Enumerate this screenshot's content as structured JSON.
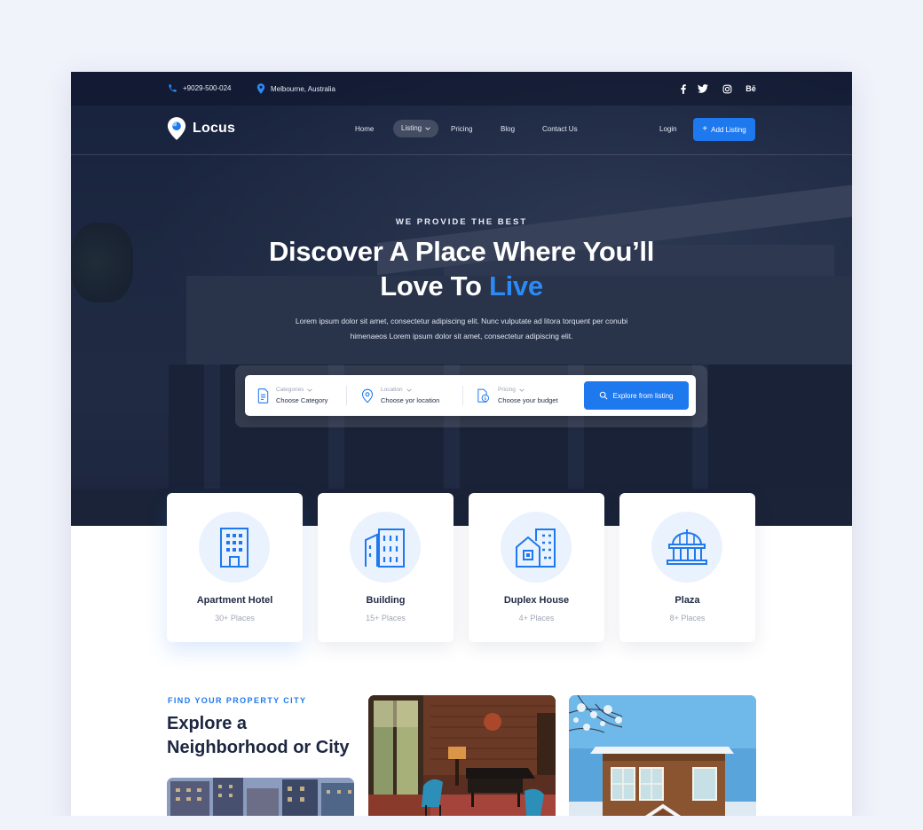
{
  "topbar": {
    "phone": "+9029-500-024",
    "location": "Melbourne, Australia",
    "social": [
      "f",
      "t",
      "ig",
      "Bē"
    ]
  },
  "nav": {
    "brand": "Locus",
    "links": {
      "home": "Home",
      "listing": "Listing",
      "pricing": "Pricing",
      "blog": "Blog",
      "contact": "Contact Us"
    },
    "login": "Login",
    "add_listing": "Add Listing"
  },
  "hero": {
    "eyebrow": "WE PROVIDE THE BEST",
    "title_line1": "Discover A Place Where You’ll",
    "title_line2_prefix": "Love To",
    "title_line2_accent": "Live",
    "lead_line1": "Lorem ipsum dolor sit amet, consectetur adipiscing elit. Nunc vulputate ad litora torquent per conubi",
    "lead_line2": "himenaeos Lorem ipsum dolor sit amet, consectetur adipiscing elit."
  },
  "search": {
    "category_label": "Categories",
    "category_value": "Choose Category",
    "location_label": "Location",
    "location_value": "Choose yor location",
    "pricing_label": "Pricing",
    "pricing_value": "Choose your budget",
    "button": "Explore from listing"
  },
  "categories": [
    {
      "name": "Apartment Hotel",
      "count": "30+ Places",
      "icon": "apartment-icon"
    },
    {
      "name": "Building",
      "count": "15+ Places",
      "icon": "building-icon"
    },
    {
      "name": "Duplex House",
      "count": "4+ Places",
      "icon": "duplex-house-icon"
    },
    {
      "name": "Plaza",
      "count": "8+ Places",
      "icon": "plaza-icon"
    }
  ],
  "explore": {
    "eyebrow": "FIND YOUR PROPERTY CITY",
    "title": "Explore a Neighborhood or City"
  },
  "colors": {
    "accent": "#1e78ee",
    "dark": "#1d2741",
    "hero": "#27334f"
  }
}
